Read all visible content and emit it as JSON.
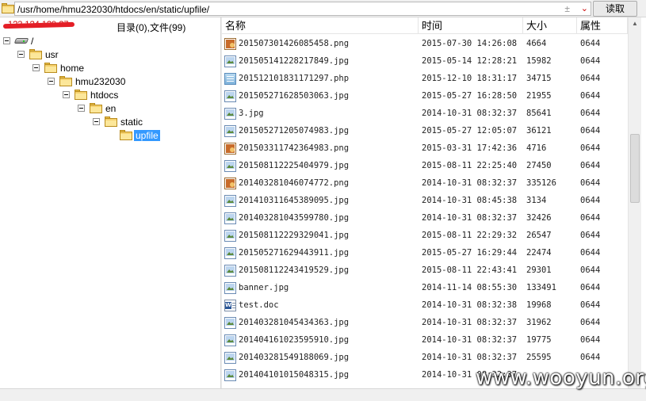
{
  "address_bar": {
    "path": "/usr/home/hmu232030/htdocs/en/static/upfile/",
    "side_controls": "±",
    "dropdown_glyph": "⌄",
    "read_button": "读取"
  },
  "left_panel": {
    "server_label": "1?2.1?4.1?9.?7",
    "counts_label": "目录(0),文件(99)"
  },
  "tree": {
    "root": "/",
    "nodes": [
      {
        "label": "usr"
      },
      {
        "label": "home"
      },
      {
        "label": "hmu232030"
      },
      {
        "label": "htdocs"
      },
      {
        "label": "en"
      },
      {
        "label": "static"
      },
      {
        "label": "upfile",
        "selected": true
      }
    ]
  },
  "file_list": {
    "columns": {
      "name": "名称",
      "time": "时间",
      "size": "大小",
      "attr": "属性"
    },
    "rows": [
      {
        "icon": "png-image-icon",
        "name": "201507301426085458.png",
        "time": "2015-07-30 14:26:08",
        "size": "4664",
        "attr": "0644"
      },
      {
        "icon": "jpg-image-icon",
        "name": "201505141228217849.jpg",
        "time": "2015-05-14 12:28:21",
        "size": "15982",
        "attr": "0644"
      },
      {
        "icon": "php-file-icon",
        "name": "201512101831171297.php",
        "time": "2015-12-10 18:31:17",
        "size": "34715",
        "attr": "0644"
      },
      {
        "icon": "jpg-image-icon",
        "name": "201505271628503063.jpg",
        "time": "2015-05-27 16:28:50",
        "size": "21955",
        "attr": "0644"
      },
      {
        "icon": "jpg-image-icon",
        "name": "3.jpg",
        "time": "2014-10-31 08:32:37",
        "size": "85641",
        "attr": "0644"
      },
      {
        "icon": "jpg-image-icon",
        "name": "201505271205074983.jpg",
        "time": "2015-05-27 12:05:07",
        "size": "36121",
        "attr": "0644"
      },
      {
        "icon": "png-image-icon",
        "name": "201503311742364983.png",
        "time": "2015-03-31 17:42:36",
        "size": "4716",
        "attr": "0644"
      },
      {
        "icon": "jpg-image-icon",
        "name": "201508112225404979.jpg",
        "time": "2015-08-11 22:25:40",
        "size": "27450",
        "attr": "0644"
      },
      {
        "icon": "png-image-icon",
        "name": "201403281046074772.png",
        "time": "2014-10-31 08:32:37",
        "size": "335126",
        "attr": "0644"
      },
      {
        "icon": "jpg-image-icon",
        "name": "201410311645389095.jpg",
        "time": "2014-10-31 08:45:38",
        "size": "3134",
        "attr": "0644"
      },
      {
        "icon": "jpg-image-icon",
        "name": "201403281043599780.jpg",
        "time": "2014-10-31 08:32:37",
        "size": "32426",
        "attr": "0644"
      },
      {
        "icon": "jpg-image-icon",
        "name": "201508112229329041.jpg",
        "time": "2015-08-11 22:29:32",
        "size": "26547",
        "attr": "0644"
      },
      {
        "icon": "jpg-image-icon",
        "name": "201505271629443911.jpg",
        "time": "2015-05-27 16:29:44",
        "size": "22474",
        "attr": "0644"
      },
      {
        "icon": "jpg-image-icon",
        "name": "201508112243419529.jpg",
        "time": "2015-08-11 22:43:41",
        "size": "29301",
        "attr": "0644"
      },
      {
        "icon": "jpg-image-icon",
        "name": "banner.jpg",
        "time": "2014-11-14 08:55:30",
        "size": "133491",
        "attr": "0644"
      },
      {
        "icon": "word-doc-icon",
        "name": "test.doc",
        "time": "2014-10-31 08:32:38",
        "size": "19968",
        "attr": "0644"
      },
      {
        "icon": "jpg-image-icon",
        "name": "201403281045434363.jpg",
        "time": "2014-10-31 08:32:37",
        "size": "31962",
        "attr": "0644"
      },
      {
        "icon": "jpg-image-icon",
        "name": "201404161023595910.jpg",
        "time": "2014-10-31 08:32:37",
        "size": "19775",
        "attr": "0644"
      },
      {
        "icon": "jpg-image-icon",
        "name": "201403281549188069.jpg",
        "time": "2014-10-31 08:32:37",
        "size": "25595",
        "attr": "0644"
      },
      {
        "icon": "jpg-image-icon",
        "name": "201404101015048315.jpg",
        "time": "2014-10-31 08:32:37",
        "size": "",
        "attr": ""
      }
    ]
  },
  "watermark": "www.wooyun.org",
  "colors": {
    "selection": "#3399ff",
    "redaction": "#e41e26",
    "folder": "#f6d26e"
  }
}
